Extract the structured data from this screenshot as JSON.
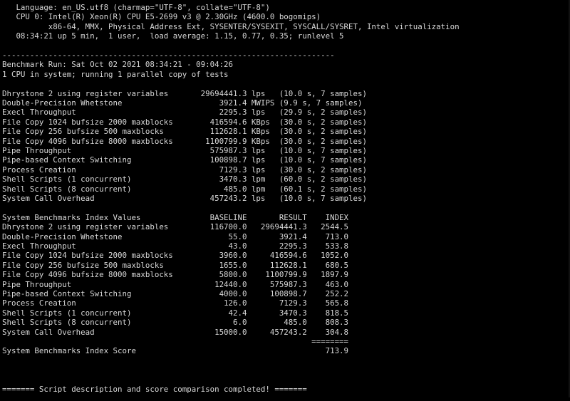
{
  "header": {
    "language": "   Language: en_US.utf8 (charmap=\"UTF-8\", collate=\"UTF-8\")",
    "cpu": "   CPU 0: Intel(R) Xeon(R) CPU E5-2699 v3 @ 2.30GHz (4600.0 bogomips)",
    "cpu_flags": "          x86-64, MMX, Physical Address Ext, SYSENTER/SYSEXIT, SYSCALL/SYSRET, Intel virtualization",
    "uptime": "   08:34:21 up 5 min,  1 user,  load average: 1.15, 0.77, 0.35; runlevel 5"
  },
  "separator": "------------------------------------------------------------------------",
  "run": {
    "benchmark_run": "Benchmark Run: Sat Oct 02 2021 08:34:21 - 09:04:26",
    "cpu_info": "1 CPU in system; running 1 parallel copy of tests"
  },
  "results": [
    "Dhrystone 2 using register variables       29694441.3 lps   (10.0 s, 7 samples)",
    "Double-Precision Whetstone                     3921.4 MWIPS (9.9 s, 7 samples)",
    "Execl Throughput                               2295.3 lps   (29.9 s, 2 samples)",
    "File Copy 1024 bufsize 2000 maxblocks        416594.6 KBps  (30.0 s, 2 samples)",
    "File Copy 256 bufsize 500 maxblocks          112628.1 KBps  (30.0 s, 2 samples)",
    "File Copy 4096 bufsize 8000 maxblocks       1100799.9 KBps  (30.0 s, 2 samples)",
    "Pipe Throughput                              575987.3 lps   (10.0 s, 7 samples)",
    "Pipe-based Context Switching                 100898.7 lps   (10.0 s, 7 samples)",
    "Process Creation                               7129.3 lps   (30.0 s, 2 samples)",
    "Shell Scripts (1 concurrent)                   3470.3 lpm   (60.0 s, 2 samples)",
    "Shell Scripts (8 concurrent)                    485.0 lpm   (60.1 s, 2 samples)",
    "System Call Overhead                         457243.2 lps   (10.0 s, 7 samples)"
  ],
  "index": {
    "header": "System Benchmarks Index Values               BASELINE       RESULT    INDEX",
    "rows": [
      "Dhrystone 2 using register variables         116700.0   29694441.3   2544.5",
      "Double-Precision Whetstone                       55.0       3921.4    713.0",
      "Execl Throughput                                 43.0       2295.3    533.8",
      "File Copy 1024 bufsize 2000 maxblocks          3960.0     416594.6   1052.0",
      "File Copy 256 bufsize 500 maxblocks            1655.0     112628.1    680.5",
      "File Copy 4096 bufsize 8000 maxblocks          5800.0    1100799.9   1897.9",
      "Pipe Throughput                               12440.0     575987.3    463.0",
      "Pipe-based Context Switching                   4000.0     100898.7    252.2",
      "Process Creation                                126.0       7129.3    565.8",
      "Shell Scripts (1 concurrent)                     42.4       3470.3    818.5",
      "Shell Scripts (8 concurrent)                      6.0        485.0    808.3",
      "System Call Overhead                          15000.0     457243.2    304.8"
    ],
    "rule": "                                                                   ========",
    "score": "System Benchmarks Index Score                                         713.9"
  },
  "footer": "======= Script description and score comparison completed! ======="
}
